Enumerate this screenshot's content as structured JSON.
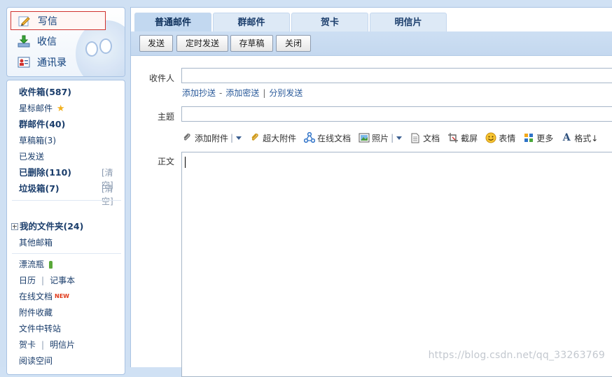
{
  "sidebar": {
    "compose": "写信",
    "inbox_action": "收信",
    "contacts": "通讯录",
    "folders": [
      {
        "label": "收件箱(587)",
        "bold": true
      },
      {
        "label": "星标邮件",
        "bold": false
      },
      {
        "label": "群邮件(40)",
        "bold": true
      },
      {
        "label": "草稿箱(3)",
        "bold": false
      },
      {
        "label": "已发送",
        "bold": false
      },
      {
        "label": "已删除(110)",
        "bold": true
      },
      {
        "label": "垃圾箱(7)",
        "bold": true
      }
    ],
    "clear_label": "[清空]",
    "my_folders": "我的文件夹(24)",
    "other_mailbox": "其他邮箱",
    "drift_bottle": "漂流瓶",
    "calendar": "日历",
    "notepad": "记事本",
    "online_docs": "在线文档",
    "new_badge": "NEW",
    "attachment_collection": "附件收藏",
    "file_transfer": "文件中转站",
    "greeting_card": "贺卡",
    "postcard": "明信片",
    "reading_space": "阅读空间",
    "separator": "|"
  },
  "tabs": [
    "普通邮件",
    "群邮件",
    "贺卡",
    "明信片"
  ],
  "toolbar": {
    "send": "发送",
    "scheduled_send": "定时发送",
    "save_draft": "存草稿",
    "close": "关闭"
  },
  "form": {
    "recipient_label": "收件人",
    "add_cc": "添加抄送",
    "add_bcc": "添加密送",
    "separate_send": "分别发送",
    "dash": "-",
    "pipe": "|",
    "subject_label": "主题",
    "body_label": "正文"
  },
  "rich_toolbar": {
    "add_attachment": "添加附件",
    "large_attachment": "超大附件",
    "online_document": "在线文档",
    "photo": "照片",
    "document": "文档",
    "screenshot": "截屏",
    "emoticon": "表情",
    "more": "更多",
    "format": "格式↓"
  },
  "watermark": "https://blog.csdn.net/qq_33263769",
  "colors": {
    "accent_blue": "#0d3d7a",
    "selection_border": "#d0322e",
    "new_badge": "#e03a1a",
    "frame_bg": "#d0e1f4"
  }
}
